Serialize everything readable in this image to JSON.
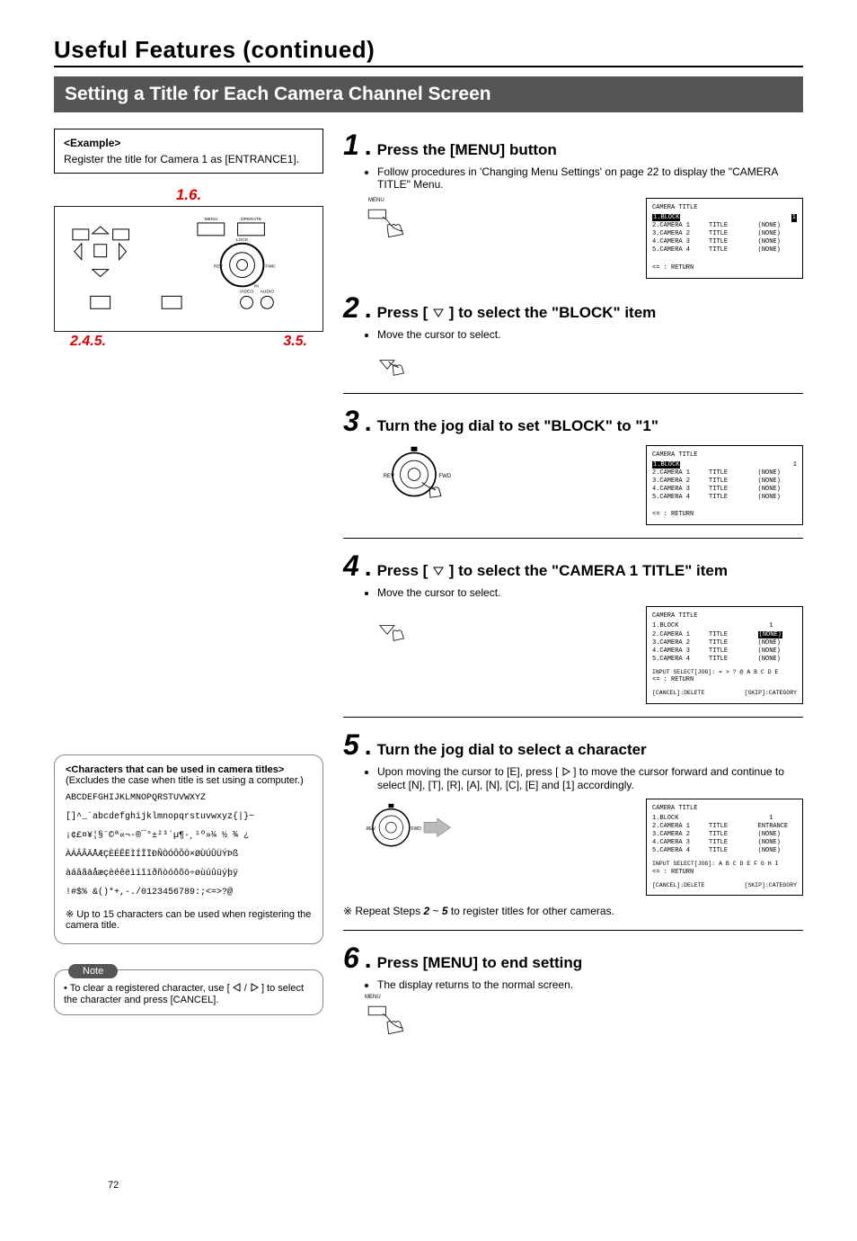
{
  "page": {
    "title": "Useful Features (continued)",
    "section": "Setting a Title for Each Camera Channel Screen",
    "number": "72"
  },
  "example": {
    "heading": "<Example>",
    "text": "Register the title for Camera 1 as [ENTRANCE1]."
  },
  "jog": {
    "caption_top": "1.6.",
    "caption_bottom_left": "2.4.5.",
    "caption_bottom_right": "3.5.",
    "labels": {
      "menu": "MENU",
      "rev": "REV",
      "fwd": "FWD",
      "lock": "LOCK",
      "operate": "OPERATE",
      "in": "IN",
      "video": "VIDEO",
      "audio": "AUDIO"
    }
  },
  "characters": {
    "title": "<Characters that can be used in camera titles>",
    "subtitle": "(Excludes the case when title is set using a computer.)",
    "line1": "ABCDEFGHIJKLMNOPQRSTUVWXYZ",
    "line2": "[]^_`abcdefghijklmnopqrstuvwxyz{|}~",
    "line3": "¡¢£¤¥¦§¨©ª«¬-®¯°±²³´µ¶·¸¹º»¼ ½ ¾ ¿",
    "line4": "ÀÁÂÃÄÅÆÇÈÉÊËÌÍÎÏÐÑÒÓÔÕÖ×ØÙÚÛÜÝÞß",
    "line5": "àáâãäåæçèéêëìíîïðñòóôõö÷øùúûüýþÿ",
    "line6": "!#$% &()*+,-./0123456789:;<=>?@",
    "note_prefix": "※",
    "note_text": "Up to 15 characters can be used when registering the camera title."
  },
  "note": {
    "label": "Note",
    "text_prefix": "• To clear a registered character, use [ ",
    "text_mid": " / ",
    "text_suffix": " ] to select the character and press [CANCEL]."
  },
  "steps": {
    "s1": {
      "num": "1",
      "title": "Press the [MENU] button",
      "bullet": "Follow procedures in 'Changing Menu Settings' on page 22 to display the \"CAMERA TITLE\" Menu.",
      "menu_label": "MENU"
    },
    "s2": {
      "num": "2",
      "title_before": "Press [ ",
      "title_after": " ] to select the \"BLOCK\" item",
      "bullet": "Move the cursor to select."
    },
    "s3": {
      "num": "3",
      "title": "Turn the jog dial to set \"BLOCK\" to \"1\"",
      "dial_rev": "REV",
      "dial_fwd": "FWD"
    },
    "s4": {
      "num": "4",
      "title_before": "Press [ ",
      "title_after": " ] to select the \"CAMERA 1 TITLE\" item",
      "bullet": "Move the cursor to select."
    },
    "s5": {
      "num": "5",
      "title": "Turn the jog dial to select a character",
      "bullet_before": "Upon moving the cursor to [E], press [ ",
      "bullet_after": " ] to move the cursor forward and continue to select [N], [T], [R], [A], [N], [C], [E] and [1] accordingly.",
      "dial_rev": "REV",
      "dial_fwd": "FWD"
    },
    "s6": {
      "num": "6",
      "title": "Press [MENU] to end setting",
      "bullet": "The display returns to the normal screen.",
      "menu_label": "MENU"
    },
    "repeat_prefix": "※ Repeat Steps ",
    "repeat_bold1": "2",
    "repeat_mid": " ~ ",
    "repeat_bold2": "5",
    "repeat_suffix": " to register titles for other cameras."
  },
  "osd": {
    "title": "CAMERA TITLE",
    "block_row": "1.BLOCK",
    "rows": [
      "2.CAMERA 1     TITLE        (NONE)",
      "3.CAMERA 2     TITLE        (NONE)",
      "4.CAMERA 3     TITLE        (NONE)",
      "5.CAMERA 4     TITLE        (NONE)"
    ],
    "return": "<= : RETURN",
    "block_row_num": "1.BLOCK                        1",
    "input_select1": "INPUT SELECT[JOG]:   =  >  ?  @  A  B  C  D  E",
    "input_select2": "INPUT SELECT[JOG]:   A  B  C  D  E  F  G  H  I",
    "cancel": "[CANCEL]:DELETE",
    "skip": "[SKIP]:CATEGORY",
    "row_cam1_entr": "2.CAMERA 1     TITLE        ENTRANCE"
  }
}
